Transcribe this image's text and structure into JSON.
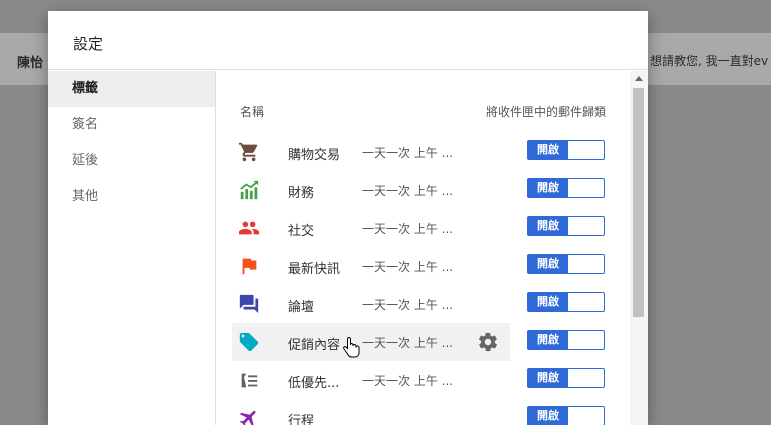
{
  "background": {
    "sender": "陳怡",
    "snippet": "想請教您, 我一直對ev"
  },
  "dialog": {
    "title": "設定",
    "nav": [
      {
        "label": "標籤",
        "active": true
      },
      {
        "label": "簽名",
        "active": false
      },
      {
        "label": "延後",
        "active": false
      },
      {
        "label": "其他",
        "active": false
      }
    ],
    "header": {
      "name_col": "名稱",
      "rule_col": "將收件匣中的郵件歸類"
    },
    "categories": [
      {
        "label": "購物交易",
        "schedule": "一天一次 上午 ...",
        "toggle": "開啟",
        "icon": "cart-icon",
        "color": "#6d4c41"
      },
      {
        "label": "財務",
        "schedule": "一天一次 上午 ...",
        "toggle": "開啟",
        "icon": "chart-icon",
        "color": "#43a047"
      },
      {
        "label": "社交",
        "schedule": "一天一次 上午 ...",
        "toggle": "開啟",
        "icon": "people-icon",
        "color": "#e53935"
      },
      {
        "label": "最新快訊",
        "schedule": "一天一次 上午 ...",
        "toggle": "開啟",
        "icon": "flag-icon",
        "color": "#f4511e"
      },
      {
        "label": "論壇",
        "schedule": "一天一次 上午 ...",
        "toggle": "開啟",
        "icon": "forum-icon",
        "color": "#3949ab"
      },
      {
        "label": "促銷內容",
        "schedule": "一天一次 上午 ...",
        "toggle": "開啟",
        "icon": "tag-icon",
        "color": "#00acc1"
      },
      {
        "label": "低優先...",
        "schedule": "一天一次 上午 ...",
        "toggle": "開啟",
        "icon": "low-priority-icon",
        "color": "#616161"
      },
      {
        "label": "行程",
        "schedule": "",
        "toggle": "開啟",
        "icon": "plane-icon",
        "color": "#8e24aa"
      }
    ],
    "accent": "#2f6ad8"
  }
}
